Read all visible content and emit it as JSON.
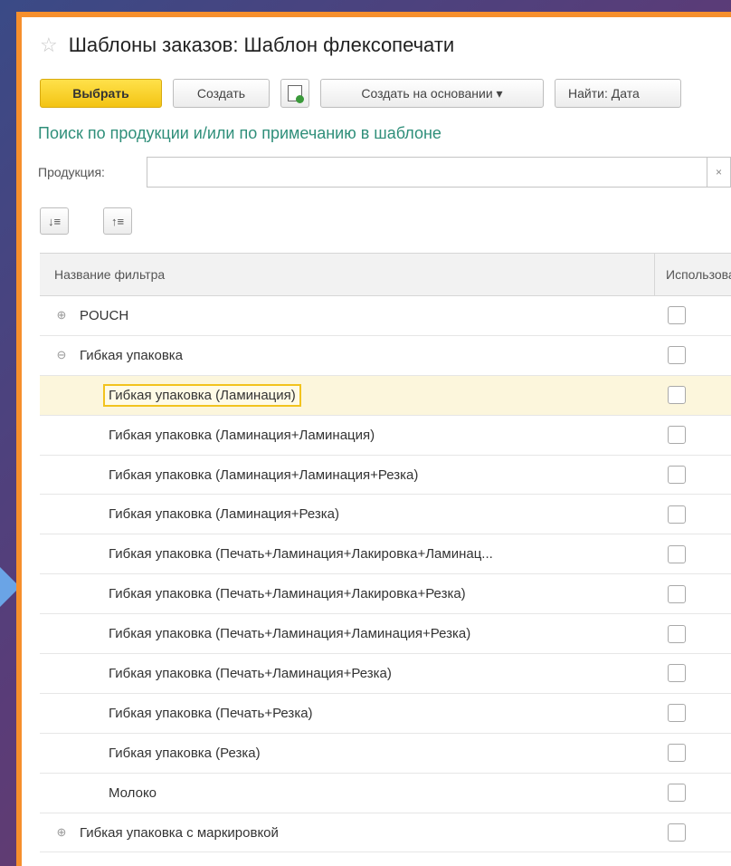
{
  "window": {
    "title": "Шаблоны заказов: Шаблон флексопечати",
    "star_icon": "☆"
  },
  "toolbar": {
    "select_label": "Выбрать",
    "create_label": "Создать",
    "create_based_label": "Создать на основании ▾",
    "find_label": "Найти: Дата"
  },
  "search": {
    "hint": "Поиск по продукции и/или по примечанию в шаблоне",
    "product_label": "Продукция:",
    "product_value": "",
    "clear_icon": "×"
  },
  "sort": {
    "sort_desc_icon": "↓≡",
    "sort_asc_icon": "↑≡"
  },
  "table": {
    "columns": [
      "Название фильтра",
      "Использовать"
    ],
    "rows": [
      {
        "label": "POUCH",
        "expander": "⊕"
      },
      {
        "label": "Гибкая упаковка",
        "expander": "⊖"
      },
      {
        "label": "Гибкая упаковка (Ламинация)"
      },
      {
        "label": "Гибкая упаковка (Ламинация+Ламинация)"
      },
      {
        "label": "Гибкая упаковка (Ламинация+Ламинация+Резка)"
      },
      {
        "label": "Гибкая упаковка (Ламинация+Резка)"
      },
      {
        "label": "Гибкая упаковка (Печать+Ламинация+Лакировка+Ламинац..."
      },
      {
        "label": "Гибкая упаковка (Печать+Ламинация+Лакировка+Резка)"
      },
      {
        "label": "Гибкая упаковка (Печать+Ламинация+Ламинация+Резка)"
      },
      {
        "label": "Гибкая упаковка (Печать+Ламинация+Резка)"
      },
      {
        "label": "Гибкая упаковка (Печать+Резка)"
      },
      {
        "label": "Гибкая упаковка (Резка)"
      },
      {
        "label": "Молоко"
      },
      {
        "label": "Гибкая упаковка с маркировкой",
        "expander": "⊕"
      }
    ]
  },
  "colors": {
    "frame": "#f68f2c",
    "primary_button": "#f3c414",
    "hint_text": "#2f8f7a",
    "selected_row": "#fcf6dc"
  }
}
